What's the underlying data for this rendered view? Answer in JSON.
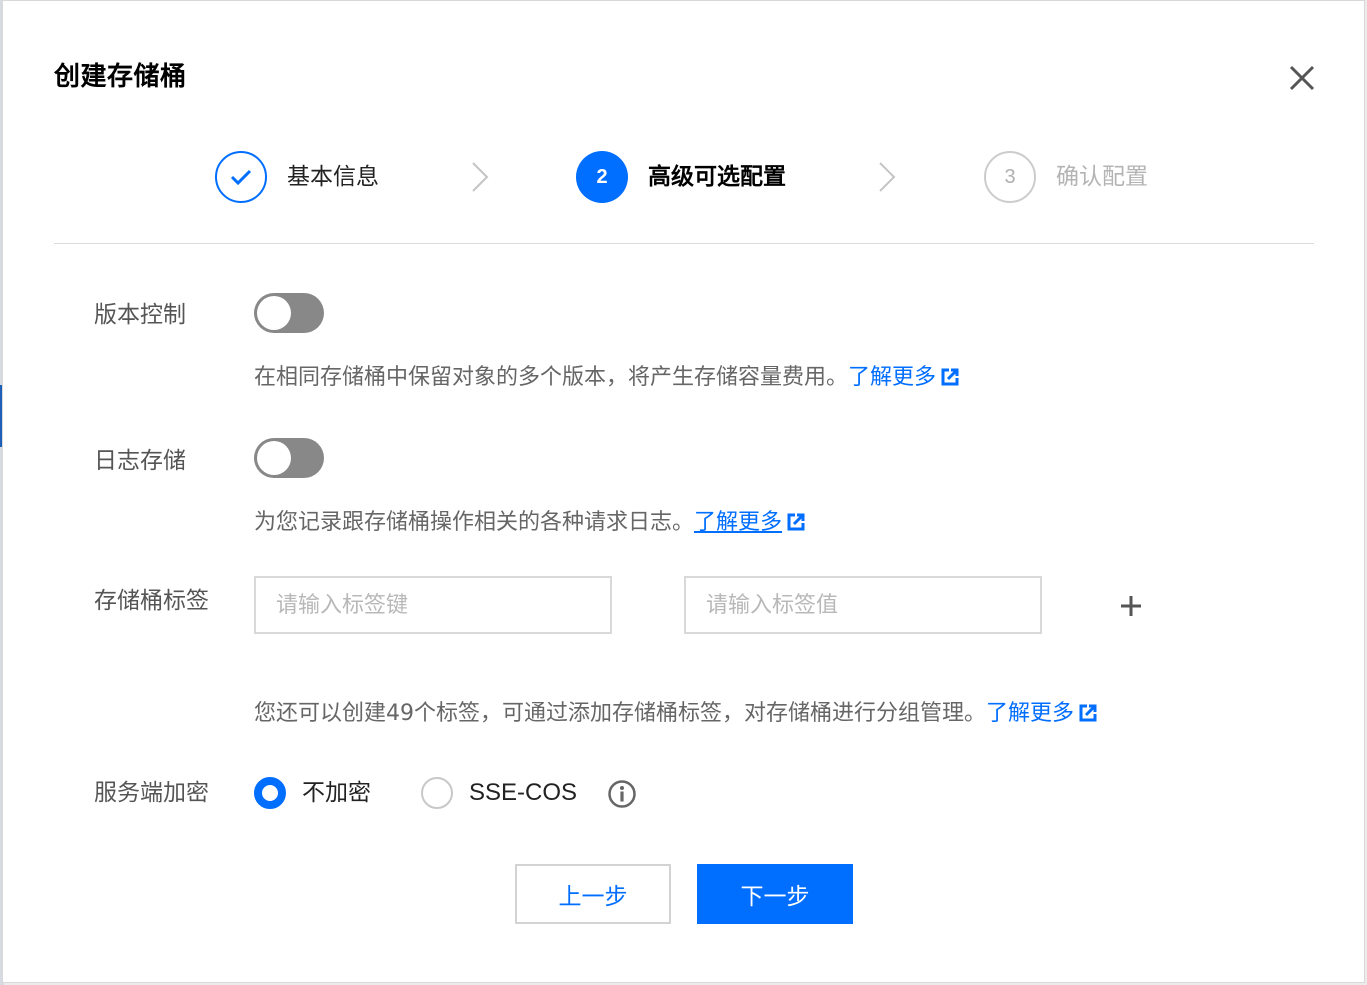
{
  "dialog": {
    "title": "创建存储桶",
    "close_icon": "close-icon"
  },
  "steps": [
    {
      "number": "1",
      "label": "基本信息",
      "state": "done"
    },
    {
      "number": "2",
      "label": "高级可选配置",
      "state": "active"
    },
    {
      "number": "3",
      "label": "确认配置",
      "state": "todo"
    }
  ],
  "versioning": {
    "label": "版本控制",
    "enabled": false,
    "description": "在相同存储桶中保留对象的多个版本，将产生存储容量费用。",
    "link": "了解更多"
  },
  "logging": {
    "label": "日志存储",
    "enabled": false,
    "description": "为您记录跟存储桶操作相关的各种请求日志。",
    "link": "了解更多"
  },
  "tags": {
    "label": "存储桶标签",
    "key_placeholder": "请输入标签键",
    "value_placeholder": "请输入标签值",
    "key_value": "",
    "value_value": "",
    "description": "您还可以创建49个标签，可通过添加存储桶标签，对存储桶进行分组管理。",
    "link": "了解更多"
  },
  "encryption": {
    "label": "服务端加密",
    "options": [
      {
        "label": "不加密",
        "selected": true
      },
      {
        "label": "SSE-COS",
        "selected": false
      }
    ]
  },
  "footer": {
    "prev_label": "上一步",
    "next_label": "下一步"
  },
  "colors": {
    "accent": "#006eff",
    "toggle_off": "#888888",
    "muted_text": "#666666"
  }
}
